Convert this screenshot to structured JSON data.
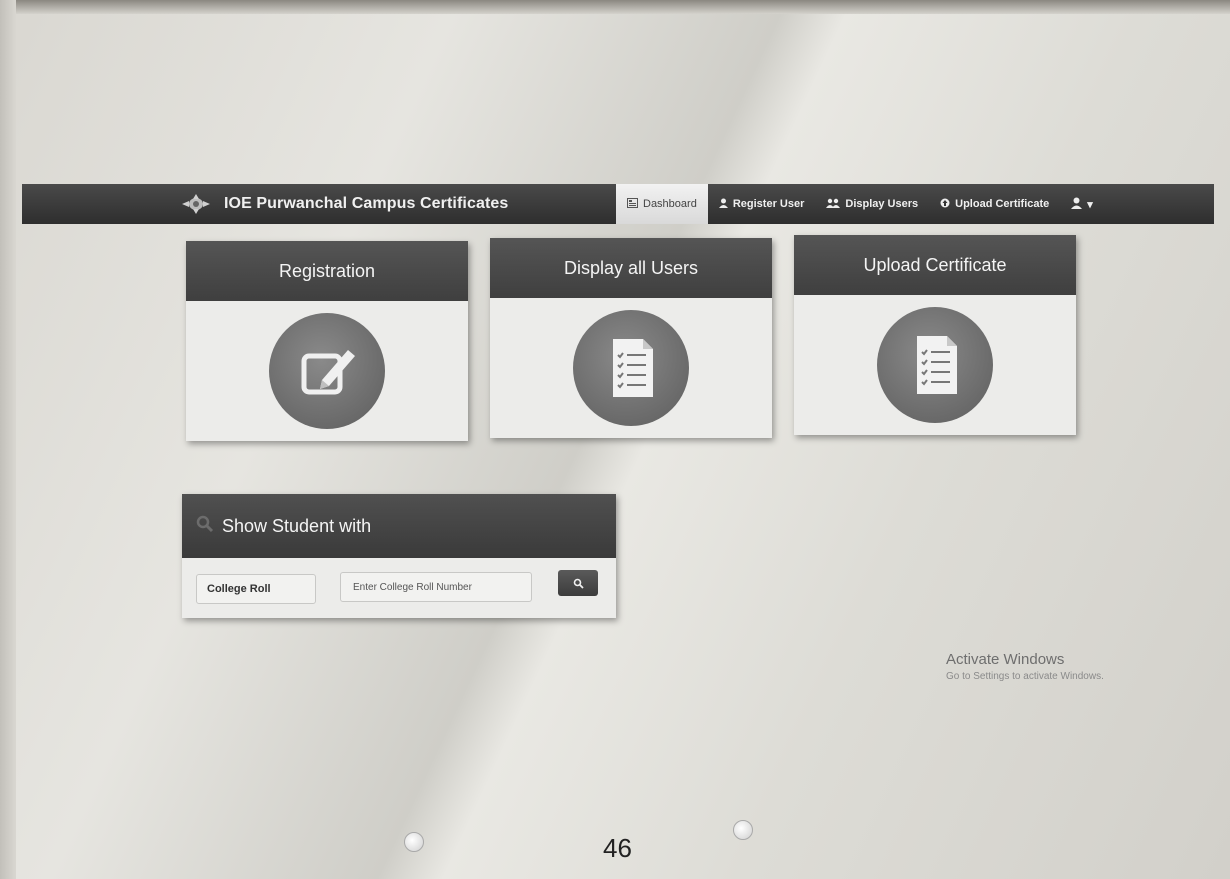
{
  "navbar": {
    "brand": "IOE Purwanchal Campus Certificates",
    "items": [
      {
        "label": "Dashboard",
        "icon": "dashboard-icon",
        "active": true
      },
      {
        "label": "Register User",
        "icon": "user-icon",
        "active": false
      },
      {
        "label": "Display Users",
        "icon": "users-icon",
        "active": false
      },
      {
        "label": "Upload Certificate",
        "icon": "upload-icon",
        "active": false
      }
    ],
    "user_menu_icon": "user-icon",
    "caret": "▾"
  },
  "tiles": [
    {
      "title": "Registration",
      "icon": "edit-icon"
    },
    {
      "title": "Display all Users",
      "icon": "document-list-icon"
    },
    {
      "title": "Upload Certificate",
      "icon": "document-list-icon"
    }
  ],
  "search": {
    "title": "Show Student with",
    "roll_type": "College Roll",
    "placeholder": "Enter College Roll Number",
    "button_icon": "search-icon"
  },
  "watermark": {
    "title": "Activate Windows",
    "subtitle": "Go to Settings to activate Windows."
  },
  "page_number": "46",
  "colors": {
    "navbar": "#3a3a3a",
    "tile_header": "#4a4a4a",
    "icon_circle": "#6e6e6e",
    "paper": "#e2e1dc"
  }
}
